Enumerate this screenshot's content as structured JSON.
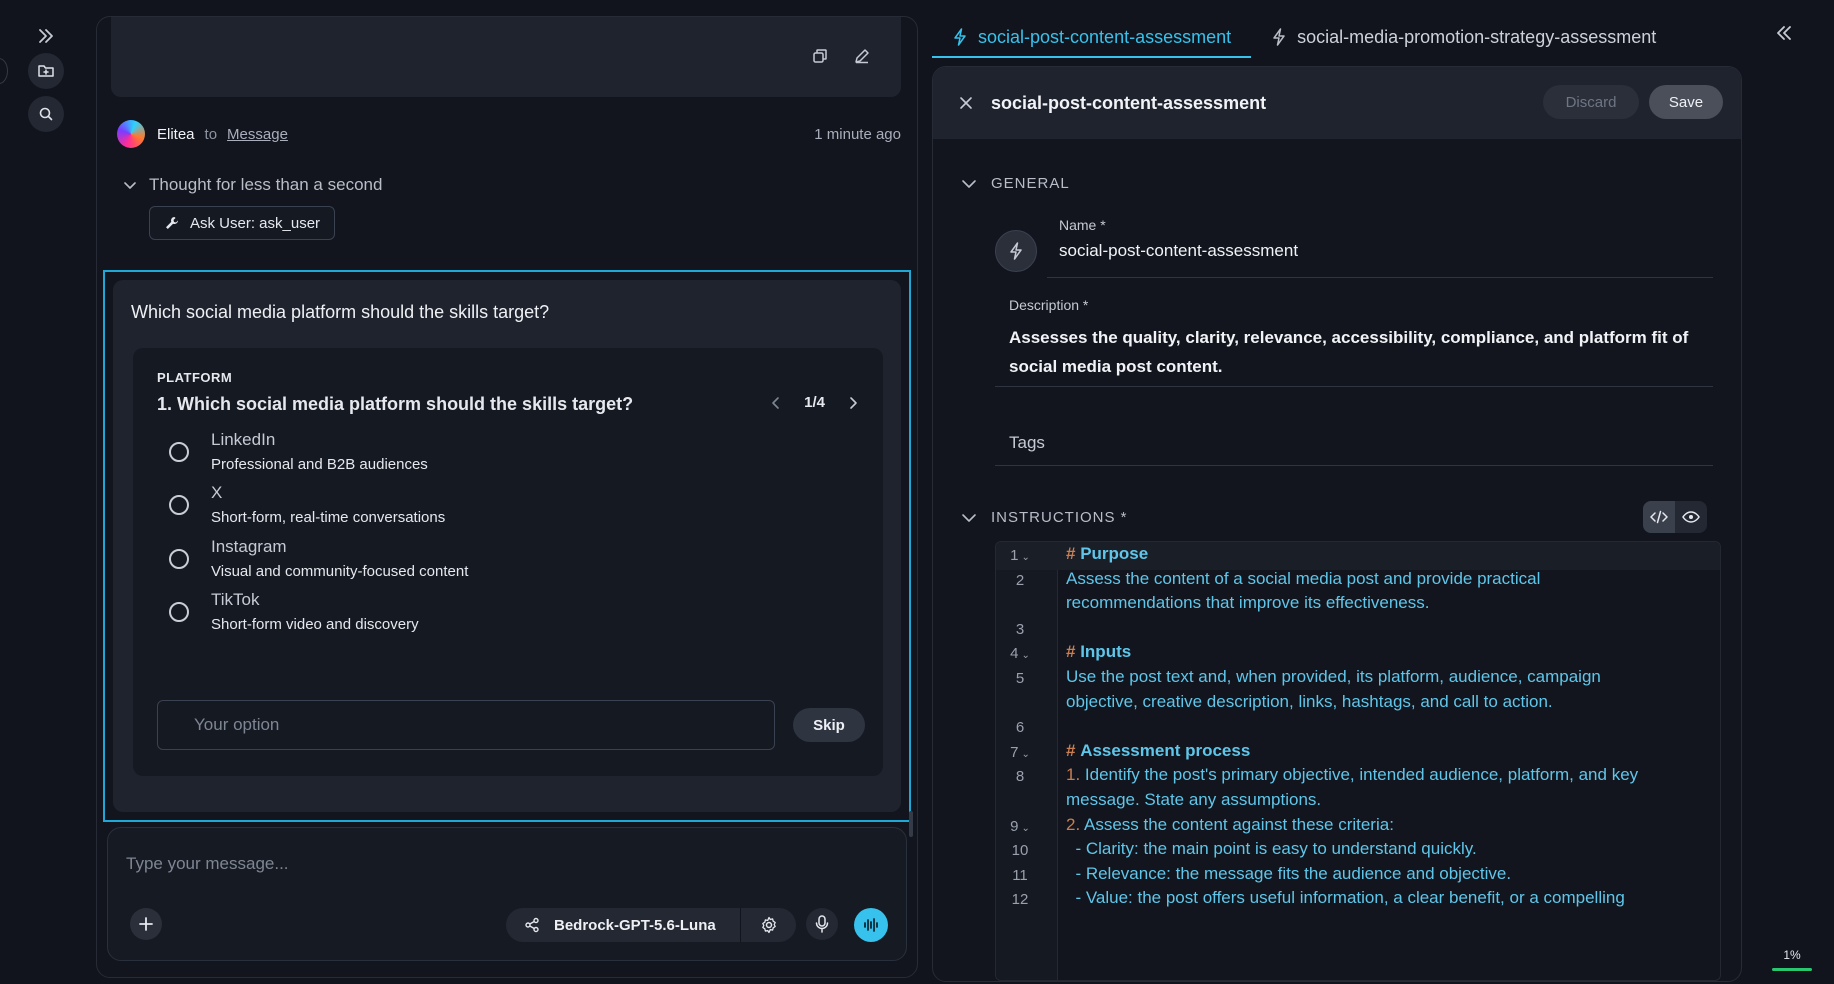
{
  "rail": {
    "expand_icon": "double-chevron-right-icon",
    "folder_icon": "folder-plus-icon",
    "search_icon": "search-icon"
  },
  "chat": {
    "sender": "Elitea",
    "to_word": "to",
    "target": "Message",
    "time": "1 minute ago",
    "thought": "Thought for less than a second",
    "tool_chip": "Ask User: ask_user",
    "ask": {
      "title": "Which social media platform should the skills target?",
      "label": "PLATFORM",
      "question": "1. Which social media platform should the skills target?",
      "pager": "1/4",
      "options": [
        {
          "label": "LinkedIn",
          "desc": "Professional and B2B audiences"
        },
        {
          "label": "X",
          "desc": "Short-form, real-time conversations"
        },
        {
          "label": "Instagram",
          "desc": "Visual and community-focused content"
        },
        {
          "label": "TikTok",
          "desc": "Short-form video and discovery"
        }
      ],
      "your_option_placeholder": "Your option",
      "skip_label": "Skip"
    },
    "composer": {
      "placeholder": "Type your message...",
      "model": "Bedrock-GPT-5.6-Luna"
    }
  },
  "tabs": [
    {
      "label": "social-post-content-assessment",
      "active": true
    },
    {
      "label": "social-media-promotion-strategy-assessment",
      "active": false
    }
  ],
  "editor": {
    "title": "social-post-content-assessment",
    "discard_label": "Discard",
    "save_label": "Save",
    "general_header": "GENERAL",
    "name_label": "Name *",
    "name_value": "social-post-content-assessment",
    "description_label": "Description *",
    "description_value": "Assesses the quality, clarity, relevance, accessibility, compliance, and platform fit of social media post content.",
    "tags_label": "Tags",
    "instructions_header": "INSTRUCTIONS *",
    "lines": [
      {
        "n": "1",
        "fold": true,
        "hash": "#",
        "heading": "Purpose"
      },
      {
        "n": "2",
        "text": "Assess the content of a social media post and provide practical"
      },
      {
        "n": "",
        "text": "recommendations that improve its effectiveness."
      },
      {
        "n": "3",
        "text": ""
      },
      {
        "n": "4",
        "fold": true,
        "hash": "#",
        "heading": "Inputs"
      },
      {
        "n": "5",
        "text": "Use the post text and, when provided, its platform, audience, campaign"
      },
      {
        "n": "",
        "text": "objective, creative description, links, hashtags, and call to action."
      },
      {
        "n": "6",
        "text": ""
      },
      {
        "n": "7",
        "fold": true,
        "hash": "#",
        "heading": "Assessment process"
      },
      {
        "n": "8",
        "num": "1.",
        "text": "Identify the post's primary objective, intended audience, platform, and key"
      },
      {
        "n": "",
        "text": "message. State any assumptions."
      },
      {
        "n": "9",
        "fold": true,
        "num": "2.",
        "text": "Assess the content against these criteria:"
      },
      {
        "n": "10",
        "text": "  - Clarity: the main point is easy to understand quickly."
      },
      {
        "n": "11",
        "text": "  - Relevance: the message fits the audience and objective."
      },
      {
        "n": "12",
        "text": "  - Value: the post offers useful information, a clear benefit, or a compelling"
      }
    ]
  },
  "progress": {
    "value": "1%",
    "fraction": 0.01
  },
  "colors": {
    "accent": "#36c2ec",
    "highlight_border": "#1fa8d6",
    "hash": "#c97e52",
    "progress": "#28c76f"
  }
}
